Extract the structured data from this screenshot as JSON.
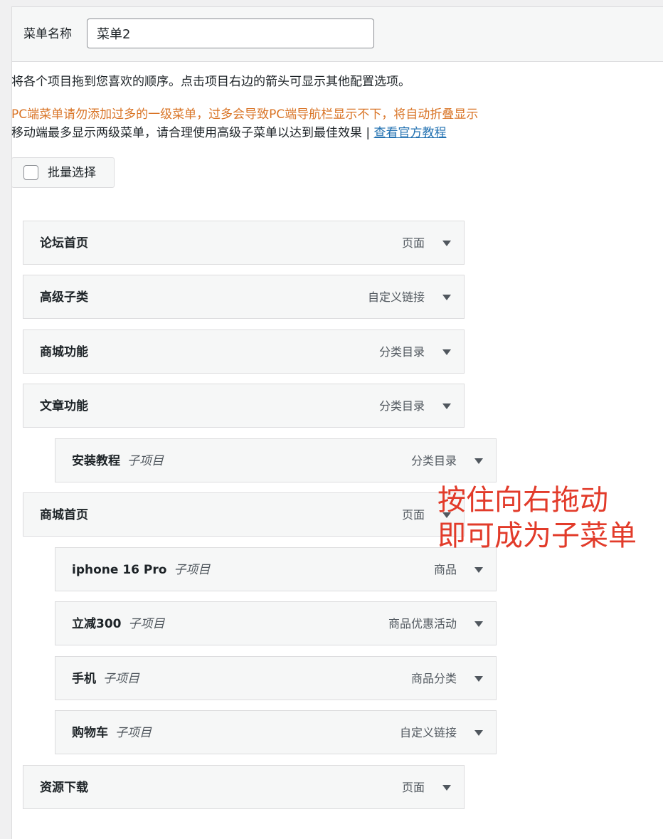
{
  "menu_name": {
    "label": "菜单名称",
    "value": "菜单2"
  },
  "instruction": "将各个项目拖到您喜欢的顺序。点击项目右边的箭头可显示其他配置选项。",
  "warning": "PC端菜单请勿添加过多的一级菜单，过多会导致PC端导航栏显示不下，将自动折叠显示",
  "mobile_note": {
    "text": "移动端最多显示两级菜单，请合理使用高级子菜单以达到最佳效果 | ",
    "link": "查看官方教程"
  },
  "bulk_select": {
    "label": "批量选择"
  },
  "items": [
    {
      "title": "论坛首页",
      "sub": "",
      "type": "页面"
    },
    {
      "title": "高级子类",
      "sub": "",
      "type": "自定义链接"
    },
    {
      "title": "商城功能",
      "sub": "",
      "type": "分类目录"
    },
    {
      "title": "文章功能",
      "sub": "",
      "type": "分类目录"
    },
    {
      "title": "安装教程",
      "sub": "子项目",
      "type": "分类目录"
    },
    {
      "title": "商城首页",
      "sub": "",
      "type": "页面"
    },
    {
      "title": "iphone 16 Pro",
      "sub": "子项目",
      "type": "商品"
    },
    {
      "title": "立减300",
      "sub": "子项目",
      "type": "商品优惠活动"
    },
    {
      "title": "手机",
      "sub": "子项目",
      "type": "商品分类"
    },
    {
      "title": "购物车",
      "sub": "子项目",
      "type": "自定义链接"
    },
    {
      "title": "资源下载",
      "sub": "",
      "type": "页面"
    }
  ],
  "annotation": {
    "line1": "按住向右拖动",
    "line2": "即可成为子菜单"
  },
  "colors": {
    "warning": "#d97426",
    "link": "#2271b1",
    "annotation": "#e23b2a"
  }
}
